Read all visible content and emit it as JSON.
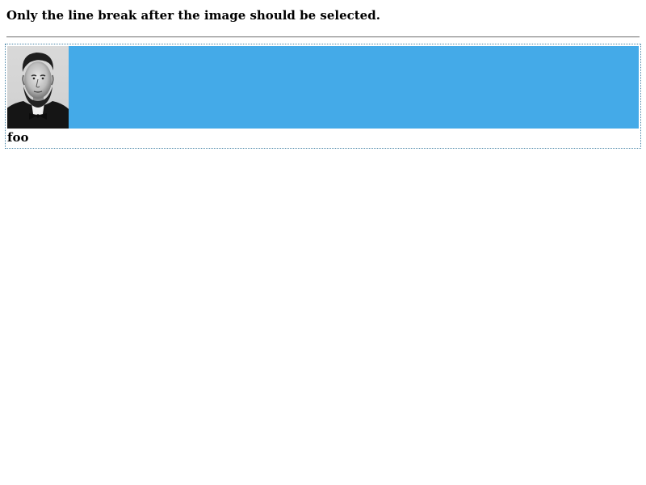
{
  "page": {
    "instruction": "Only the line break after the image should be selected.",
    "caption": "foo"
  },
  "image": {
    "subject_icon": "portrait-photo-icon"
  },
  "colors": {
    "selection": "#44aae8",
    "border": "#4a86a8",
    "divider": "#8a8a8a",
    "text": "#000000",
    "background": "#ffffff"
  }
}
